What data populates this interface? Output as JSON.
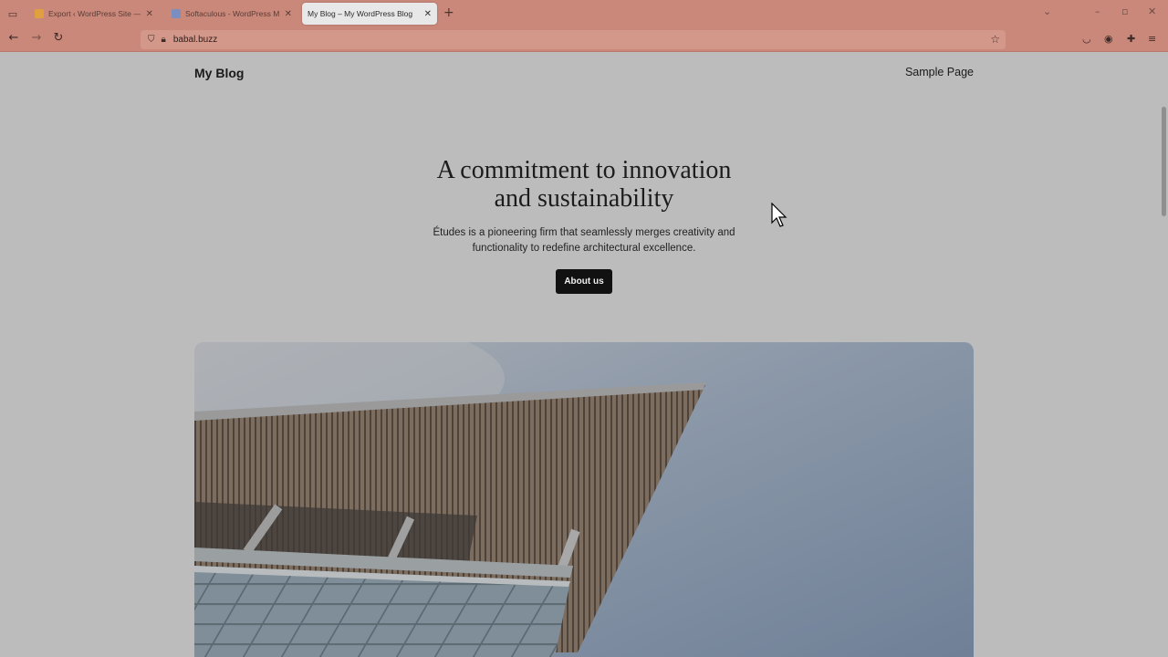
{
  "browser": {
    "tabs": [
      {
        "title": "Export ‹ WordPress Site — Wor",
        "favicon_color": "#e0a040"
      },
      {
        "title": "Softaculous - WordPress Mana",
        "favicon_color": "#7a8fbf"
      },
      {
        "title": "My Blog – My WordPress Blog",
        "favicon_color": "",
        "active": true
      }
    ],
    "url": "babal.buzz"
  },
  "site": {
    "title": "My Blog",
    "nav_item": "Sample Page"
  },
  "hero": {
    "heading_line1": "A commitment to innovation",
    "heading_line2": "and sustainability",
    "text_line1": "Études is a pioneering firm that seamlessly merges creativity and",
    "text_line2": "functionality to redefine architectural excellence.",
    "button_label": "About us"
  },
  "icons": {
    "list_all_tabs": "tabs-list-icon",
    "back": "back-arrow-icon",
    "forward": "forward-arrow-icon",
    "reload": "reload-icon",
    "shield": "shield-icon",
    "lock": "lock-icon",
    "bookmark": "star-icon",
    "pocket": "pocket-icon",
    "account": "account-icon",
    "extensions": "extensions-icon",
    "menu": "menu-icon"
  }
}
